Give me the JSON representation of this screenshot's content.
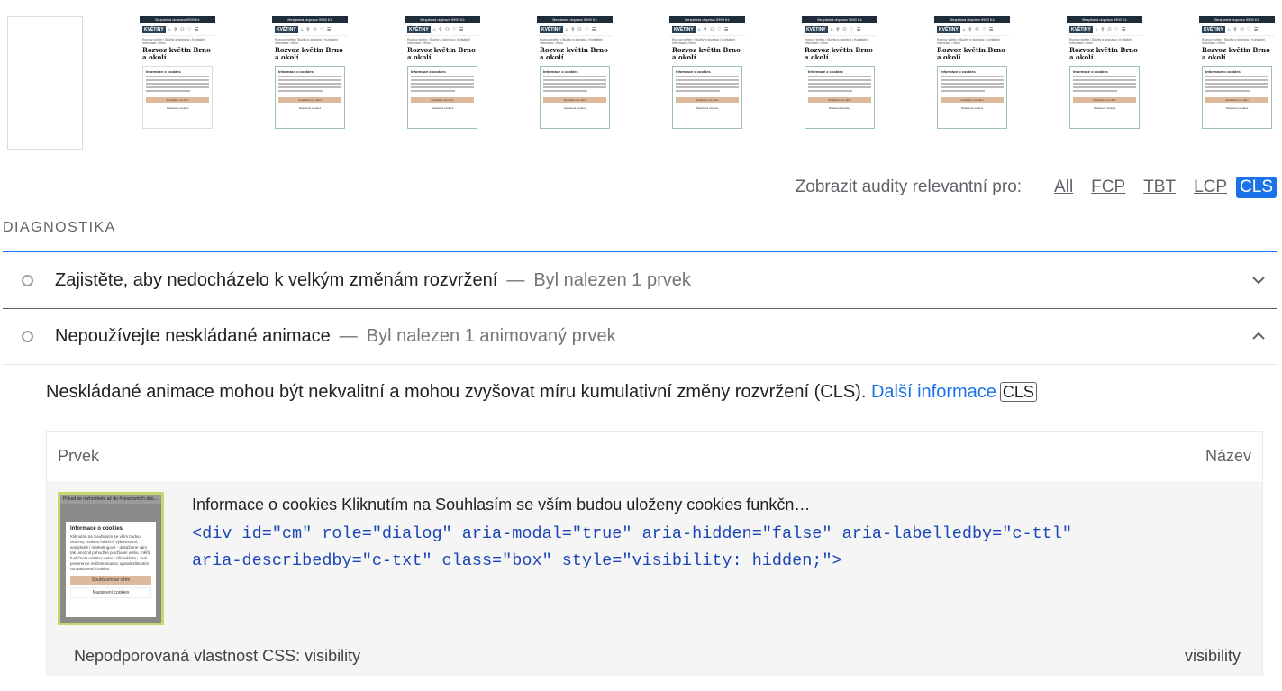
{
  "filmstrip": {
    "frames": [
      {
        "blank": true
      },
      {
        "dialog_variant": "first"
      },
      {
        "dialog_variant": "normal"
      },
      {
        "dialog_variant": "normal"
      },
      {
        "dialog_variant": "normal"
      },
      {
        "dialog_variant": "normal"
      },
      {
        "dialog_variant": "normal"
      },
      {
        "dialog_variant": "normal"
      },
      {
        "dialog_variant": "normal"
      },
      {
        "dialog_variant": "normal"
      }
    ],
    "frame_texts": {
      "topbar": "Bezplatná doprava 9990 Kč",
      "logo": "KVĚTINY",
      "icons": "⌂ ⚲ ⚇ ♡ ☰",
      "crumb": "Rozvoz květin • Služby a doprava • Kontaktní informace • Brno",
      "title": "Rozvoz květin Brno a okolí",
      "dialog_title": "Informace o cookies",
      "button_primary": "Souhlasím se vším",
      "button_secondary": "Nastavení cookies"
    }
  },
  "filter": {
    "label": "Zobrazit audity relevantní pro:",
    "chips": [
      "All",
      "FCP",
      "TBT",
      "LCP",
      "CLS"
    ],
    "active": "CLS"
  },
  "group": {
    "title": "DIAGNOSTIKA"
  },
  "audits": [
    {
      "title": "Zajistěte, aby nedocházelo k velkým změnám rozvržení",
      "separator": "—",
      "summary": "Byl nalezen 1 prvek",
      "expanded": false
    },
    {
      "title": "Nepoužívejte neskládané animace",
      "separator": "—",
      "summary": "Byl nalezen 1 animovaný prvek",
      "expanded": true
    }
  ],
  "details": {
    "description": "Neskládané animace mohou být nekvalitní a mohou zvyšovat míru kumulativní změny rozvržení (CLS).",
    "learn_more": "Další informace",
    "tag": "CLS",
    "table": {
      "headers": [
        "Prvek",
        "Název"
      ],
      "row": {
        "snippet": "Informace o cookies Kliknutím na Souhlasím se vším budou uloženy cookies funkčn…",
        "code": "<div id=\"cm\" role=\"dialog\" aria-modal=\"true\" aria-hidden=\"false\" aria-labelledby=\"c-ttl\" aria-describedby=\"c-txt\" class=\"box\" style=\"visibility: hidden;\">",
        "thumbnail": {
          "top_text": "Pokud se rozhodnete až do 4 pracovních dnů...",
          "title": "Informace o cookies",
          "text": "Kliknutím na Souhlasím se vším budou uloženy cookies funkční, výkonnostní, analytické i marketingové - dokážeme vám tak umožnit pohodlné používání webu, měřit funkčnost našeho webu i cílit reklamu. Své preference můžete snadno upravit kliknutím na Nastavení cookies.",
          "button_primary": "Souhlasím se vším",
          "button_secondary": "Nastavení cookies"
        },
        "sub_label": "Nepodporovaná vlastnost CSS: visibility",
        "sub_value": "visibility"
      }
    }
  },
  "colors": {
    "accent": "#1a73e8",
    "code": "#1b45b5",
    "highlight": "#c5d86d"
  }
}
